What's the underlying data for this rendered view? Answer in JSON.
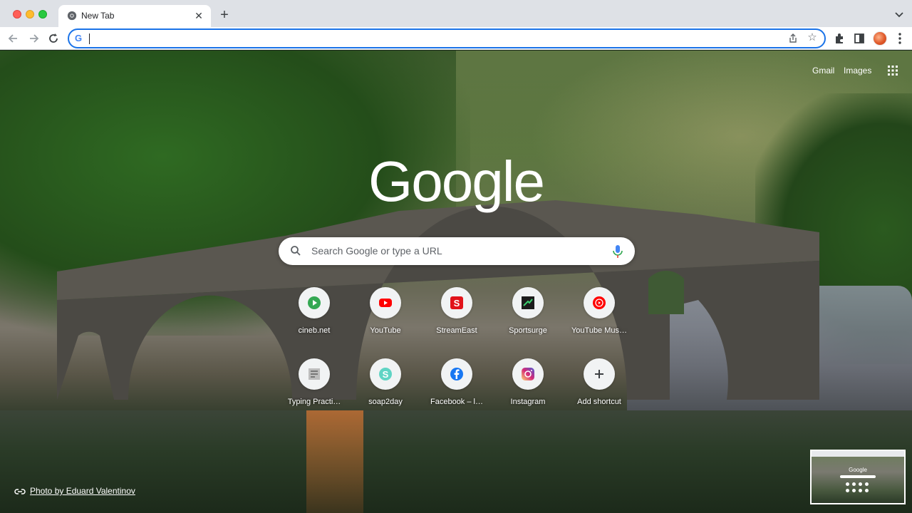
{
  "browser": {
    "tab": {
      "title": "New Tab"
    },
    "omnibox": {
      "value": ""
    }
  },
  "header": {
    "gmail_label": "Gmail",
    "images_label": "Images",
    "apps_icon": "apps-grid-icon"
  },
  "logo": {
    "text": "Google"
  },
  "search": {
    "placeholder": "Search Google or type a URL"
  },
  "shortcuts": [
    {
      "label": "cineb.net",
      "icon": "play-icon",
      "color": "#34a853"
    },
    {
      "label": "YouTube",
      "icon": "youtube-icon",
      "color": "#ff0000"
    },
    {
      "label": "StreamEast",
      "icon": "streameast-icon",
      "color": "#e1131a"
    },
    {
      "label": "Sportsurge",
      "icon": "sportsurge-icon",
      "color": "#1c1c1c"
    },
    {
      "label": "YouTube Mus…",
      "icon": "youtube-music-icon",
      "color": "#ff0000"
    },
    {
      "label": "Typing Practi…",
      "icon": "typing-icon",
      "color": "#9e9e9e"
    },
    {
      "label": "soap2day",
      "icon": "soap2day-icon",
      "color": "#5fd4c4"
    },
    {
      "label": "Facebook – l…",
      "icon": "facebook-icon",
      "color": "#1877f2"
    },
    {
      "label": "Instagram",
      "icon": "instagram-icon",
      "color": "#d6249f"
    },
    {
      "label": "Add shortcut",
      "icon": "plus-icon",
      "color": "#3c4043"
    }
  ],
  "background": {
    "credit": "Photo by Eduard Valentinov"
  },
  "thumbnail": {
    "logo_text": "Google"
  }
}
